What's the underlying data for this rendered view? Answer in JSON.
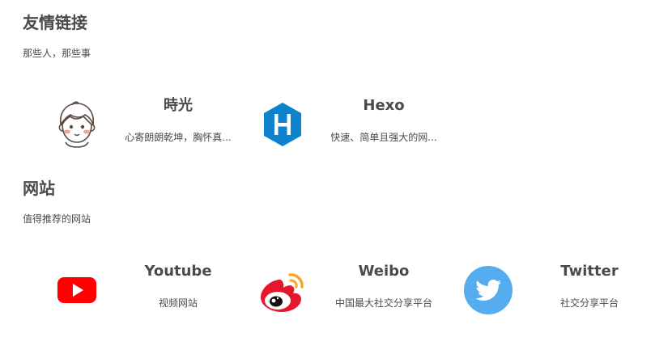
{
  "sections": [
    {
      "title": "友情链接",
      "desc": "那些人，那些事",
      "links": [
        {
          "name": "時光",
          "desc": "心寄朗朗乾坤，胸怀真...",
          "icon": "cartoon-avatar-icon"
        },
        {
          "name": "Hexo",
          "desc": "快速、简单且强大的网...",
          "icon": "hexo-logo-icon"
        }
      ]
    },
    {
      "title": "网站",
      "desc": "值得推荐的网站",
      "links": [
        {
          "name": "Youtube",
          "desc": "视频网站",
          "icon": "youtube-logo-icon"
        },
        {
          "name": "Weibo",
          "desc": "中国最大社交分享平台",
          "icon": "weibo-logo-icon"
        },
        {
          "name": "Twitter",
          "desc": "社交分享平台",
          "icon": "twitter-logo-icon"
        }
      ]
    }
  ],
  "colors": {
    "text": "#4c4948",
    "hexo": "#0e83cd",
    "youtube": "#ff0000",
    "weibo": "#e6162d",
    "weibo_accent": "#f6a623",
    "twitter": "#55acee"
  }
}
